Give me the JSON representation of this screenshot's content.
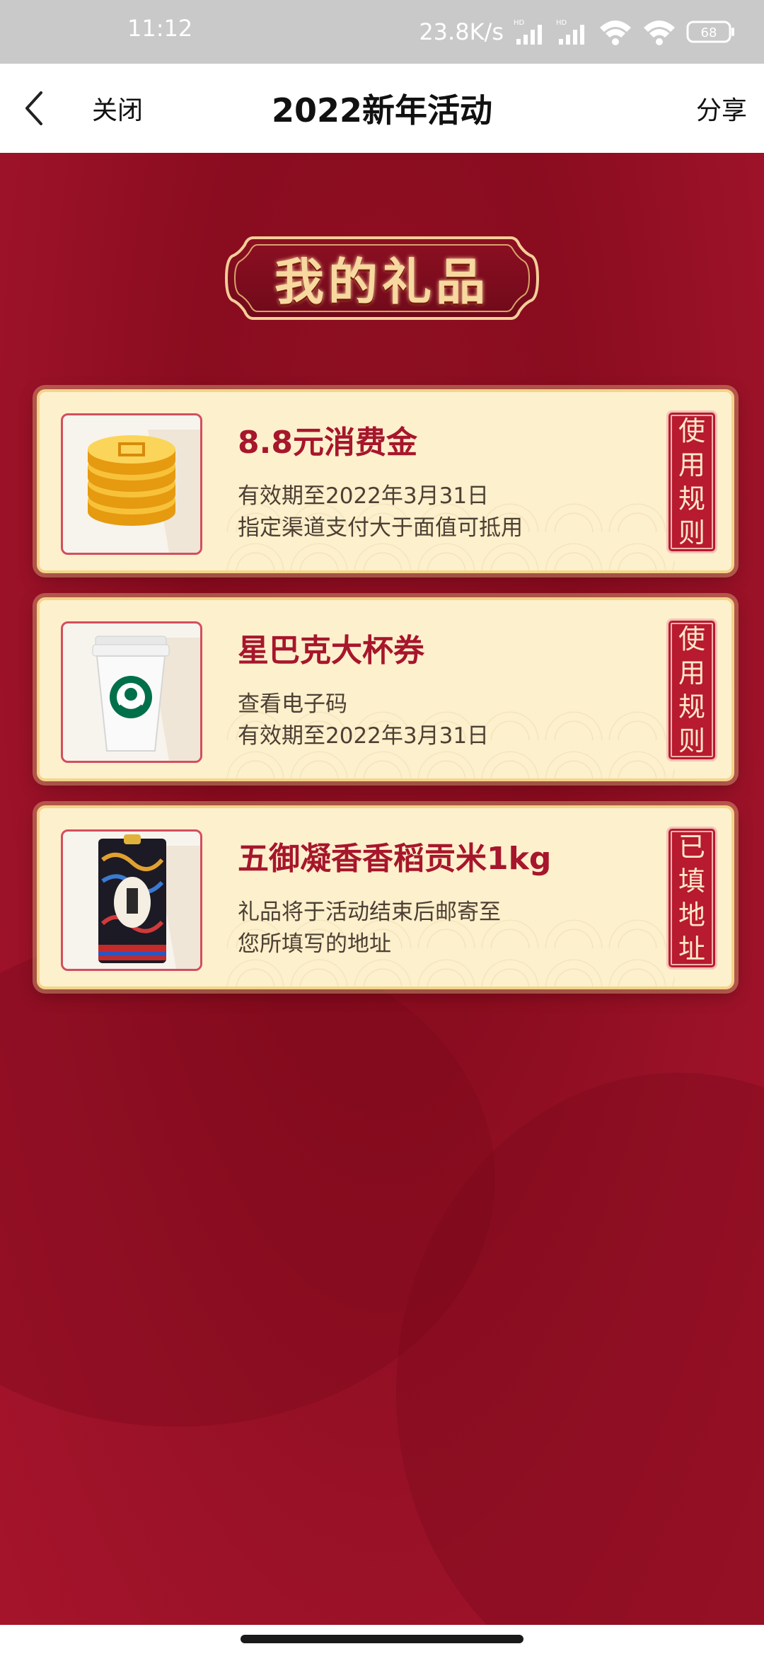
{
  "status_bar": {
    "time": "11:12",
    "net_speed": "23.8K/s",
    "battery": "68"
  },
  "title_bar": {
    "close_label": "关闭",
    "title": "2022新年活动",
    "share_label": "分享"
  },
  "banner": {
    "text": "我的礼品"
  },
  "gifts": [
    {
      "title": "8.8元消费金",
      "line1": "有效期至2022年3月31日",
      "line2": "指定渠道支付大于面值可抵用",
      "tag": [
        "使",
        "用",
        "规",
        "则"
      ],
      "image_icon": "gold-coins-icon"
    },
    {
      "title": "星巴克大杯券",
      "line1": "查看电子码",
      "line2": "有效期至2022年3月31日",
      "tag": [
        "使",
        "用",
        "规",
        "则"
      ],
      "image_icon": "coffee-cup-icon"
    },
    {
      "title": "五御凝香香稻贡米1kg",
      "line1": "礼品将于活动结束后邮寄至",
      "line2": "您所填写的地址",
      "tag": [
        "已",
        "填",
        "地",
        "址"
      ],
      "image_icon": "rice-bag-icon"
    }
  ],
  "colors": {
    "accent_red": "#a6162c",
    "card_bg": "#fdf0cc",
    "tag_red": "#b81a30"
  }
}
